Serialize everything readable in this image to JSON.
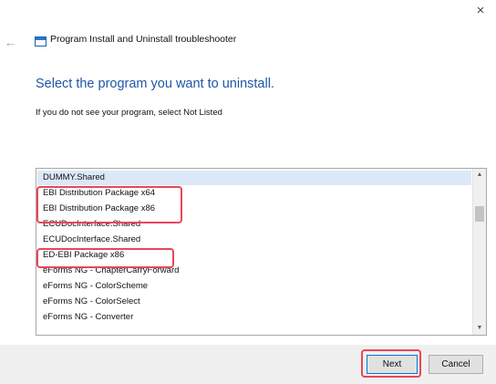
{
  "window": {
    "close_glyph": "×",
    "back_glyph": "←",
    "app_icon": "troubleshooter-window-icon",
    "title": "Program Install and Uninstall troubleshooter"
  },
  "main": {
    "heading": "Select the program you want to uninstall.",
    "instruction": "If you do not see your program, select Not Listed"
  },
  "programs": [
    "DUMMY.Shared",
    "EBI Distribution Package x64",
    "EBI Distribution Package x86",
    "ECUDocInterface.Shared",
    "ECUDocInterface.Shared",
    "ED-EBI Package x86",
    "eForms NG - ChapterCarryForward",
    "eForms NG - ColorScheme",
    "eForms NG - ColorSelect",
    "eForms NG - Converter"
  ],
  "selected_index": 0,
  "scrollbar": {
    "up_glyph": "▲",
    "down_glyph": "▼"
  },
  "footer": {
    "next_label": "Next",
    "cancel_label": "Cancel"
  },
  "colors": {
    "heading": "#1f56a8",
    "highlight": "#e8465b",
    "selection": "#dce8f7",
    "next_border": "#0078d7"
  }
}
